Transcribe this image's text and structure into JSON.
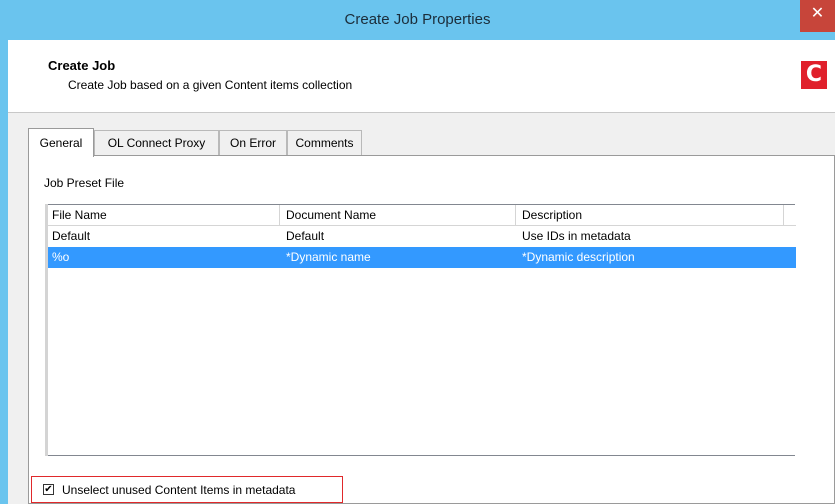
{
  "window": {
    "title": "Create Job Properties",
    "close_glyph": "✕"
  },
  "header": {
    "title": "Create Job",
    "subtitle": "Create Job based on a given Content items collection",
    "logo_letter": "C",
    "logo_color": "#e0202b"
  },
  "tabs": [
    {
      "label": "General",
      "active": true
    },
    {
      "label": "OL Connect Proxy",
      "active": false
    },
    {
      "label": "On Error",
      "active": false
    },
    {
      "label": "Comments",
      "active": false
    }
  ],
  "general": {
    "preset_label": "Job Preset File",
    "columns": [
      "File Name",
      "Document Name",
      "Description"
    ],
    "rows": [
      {
        "file": "Default",
        "doc": "Default",
        "desc": "Use IDs in metadata",
        "selected": false
      },
      {
        "file": "%o",
        "doc": "*Dynamic name",
        "desc": "*Dynamic description",
        "selected": true
      }
    ],
    "checkbox": {
      "label": "Unselect unused Content Items in metadata",
      "checked": true,
      "mark": "✔"
    }
  },
  "colors": {
    "titlebar": "#6ac4ee",
    "selection": "#3399ff",
    "close": "#c7453a"
  }
}
